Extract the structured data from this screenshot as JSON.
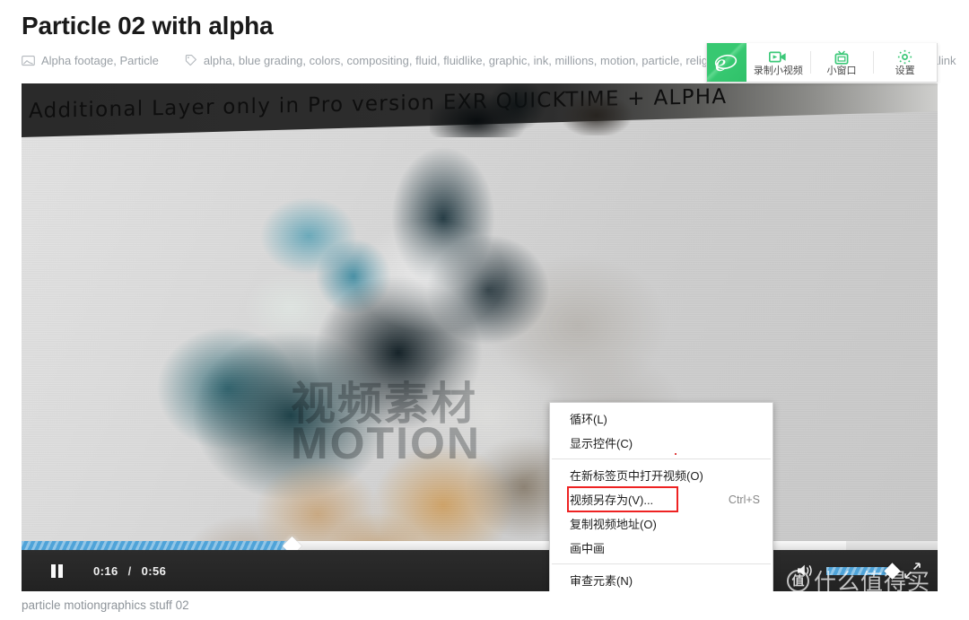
{
  "header": {
    "title": "Particle 02 with alpha",
    "categories_icon": "folder-icon",
    "categories": "Alpha footage, Particle",
    "tags_icon": "tag-icon",
    "tags": "alpha, blue grading, colors, compositing, fluid, fluidlike, graphic, ink, millions, motion, particle, relighting,",
    "tags_overflow": "alink"
  },
  "browser_toolbar": {
    "logo_icon": "ie-e-logo-icon",
    "accent_color": "#37c871",
    "items": [
      {
        "label": "录制小视频",
        "icon": "video-record-icon"
      },
      {
        "label": "小窗口",
        "icon": "mini-window-tv-icon"
      },
      {
        "label": "设置",
        "icon": "gear-icon"
      }
    ]
  },
  "player": {
    "banner_text": "Additional Layer only in Pro version EXR  QUICKTIME + ALPHA",
    "center_watermark": "视频素材\nMOTION",
    "controls": {
      "pause_icon": "pause-icon",
      "current_time": "0:16",
      "time_separator": "/",
      "duration": "0:56",
      "progress_percent": 29.5,
      "buffered_percent": 90,
      "volume_icon": "speaker-icon",
      "volume_percent": 100,
      "fullscreen_icon": "fullscreen-expand-icon",
      "accent_color": "#4fa3d8"
    },
    "watermark": {
      "badge": "值",
      "text": "什么值得买"
    }
  },
  "context_menu": {
    "items": [
      {
        "label": "循环(L)",
        "accel": "",
        "highlighted": false,
        "separator_after": false
      },
      {
        "label": "显示控件(C)",
        "accel": "",
        "highlighted": false,
        "separator_after": true
      },
      {
        "label": "在新标签页中打开视频(O)",
        "accel": "",
        "highlighted": false,
        "separator_after": false
      },
      {
        "label": "视频另存为(V)...",
        "accel": "Ctrl+S",
        "highlighted": true,
        "separator_after": false
      },
      {
        "label": "复制视频地址(O)",
        "accel": "",
        "highlighted": false,
        "separator_after": false
      },
      {
        "label": "画中画",
        "accel": "",
        "highlighted": false,
        "separator_after": true
      },
      {
        "label": "审查元素(N)",
        "accel": "",
        "highlighted": false,
        "separator_after": false
      }
    ],
    "highlight_color": "#ee2222"
  },
  "caption": "particle motiongraphics stuff 02"
}
